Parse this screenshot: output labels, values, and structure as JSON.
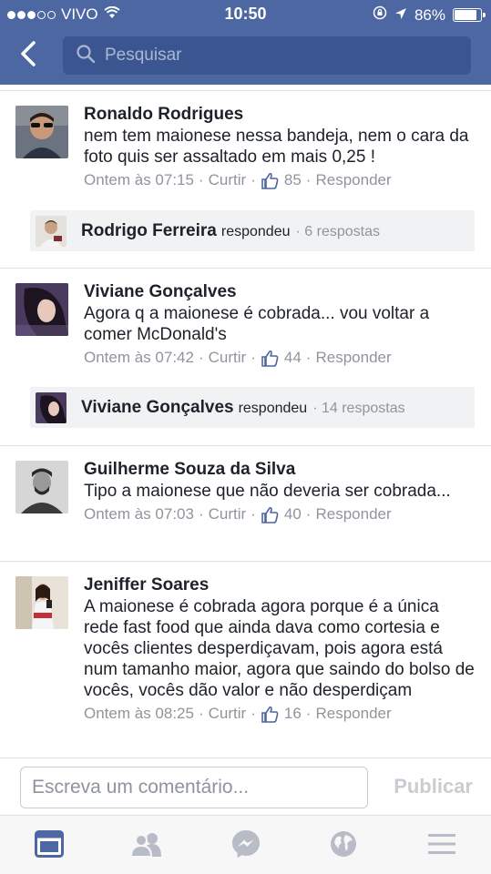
{
  "status_bar": {
    "carrier": "VIVO",
    "time": "10:50",
    "battery": "86%",
    "battery_level": 0.86
  },
  "header": {
    "back_icon": "chevron-left-icon",
    "search_placeholder": "Pesquisar"
  },
  "comments": [
    {
      "author": "Ronaldo Rodrigues",
      "text": "nem tem maionese nessa bandeja, nem o cara da foto quis ser assaltado em mais 0,25 !",
      "time": "Ontem às 07:15",
      "like_label": "Curtir",
      "likes": "85",
      "reply_label": "Responder",
      "reply_thread": {
        "name": "Rodrigo Ferreira",
        "verb": "respondeu",
        "count": "· 6 respostas"
      }
    },
    {
      "author": "Viviane Gonçalves",
      "text": "Agora q a maionese é cobrada... vou voltar a comer McDonald's",
      "time": "Ontem às 07:42",
      "like_label": "Curtir",
      "likes": "44",
      "reply_label": "Responder",
      "reply_thread": {
        "name": "Viviane Gonçalves",
        "verb": "respondeu",
        "count": "· 14 respostas"
      }
    },
    {
      "author": "Guilherme Souza da Silva",
      "text": "Tipo a maionese que não deveria ser cobrada...",
      "time": "Ontem às 07:03",
      "like_label": "Curtir",
      "likes": "40",
      "reply_label": "Responder"
    },
    {
      "author": "Jeniffer Soares",
      "text": "A maionese é cobrada agora porque é a única rede fast food que ainda dava como cortesia e vocês clientes desperdiçavam,  pois agora está num tamanho maior, agora que saindo do bolso de vocês, vocês dão valor e não desperdiçam",
      "time": "Ontem às 08:25",
      "like_label": "Curtir",
      "likes": "16",
      "reply_label": "Responder"
    }
  ],
  "composer": {
    "placeholder": "Escreva um comentário...",
    "publish_label": "Publicar"
  },
  "tabbar": {
    "items": [
      "news-feed-icon",
      "friends-icon",
      "messenger-icon",
      "notifications-globe-icon",
      "menu-icon"
    ],
    "active": "news-feed-icon"
  },
  "colors": {
    "brand": "#4c67a1",
    "active_tab": "#4c67a1",
    "inactive_tab": "#b7bcc6",
    "meta_text": "#90949c"
  }
}
